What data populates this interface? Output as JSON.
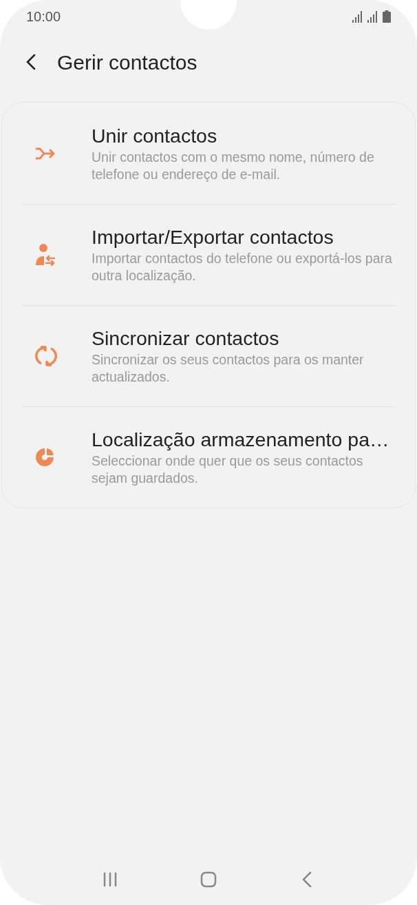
{
  "status_bar": {
    "time": "10:00"
  },
  "header": {
    "title": "Gerir contactos"
  },
  "items": [
    {
      "kind": "merge",
      "title": "Unir contactos",
      "subtitle": "Unir contactos com o mesmo nome, número de telefone ou endereço de e-mail."
    },
    {
      "kind": "import_export",
      "title": "Importar/Exportar contactos",
      "subtitle": "Importar contactos do telefone ou exportá-los para outra localização."
    },
    {
      "kind": "sync",
      "title": "Sincronizar contactos",
      "subtitle": "Sincronizar os seus contactos para os manter actualizados."
    },
    {
      "kind": "storage",
      "title": "Localização armazenamento pa…",
      "subtitle": "Seleccionar onde quer que os seus contactos sejam guardados."
    }
  ]
}
